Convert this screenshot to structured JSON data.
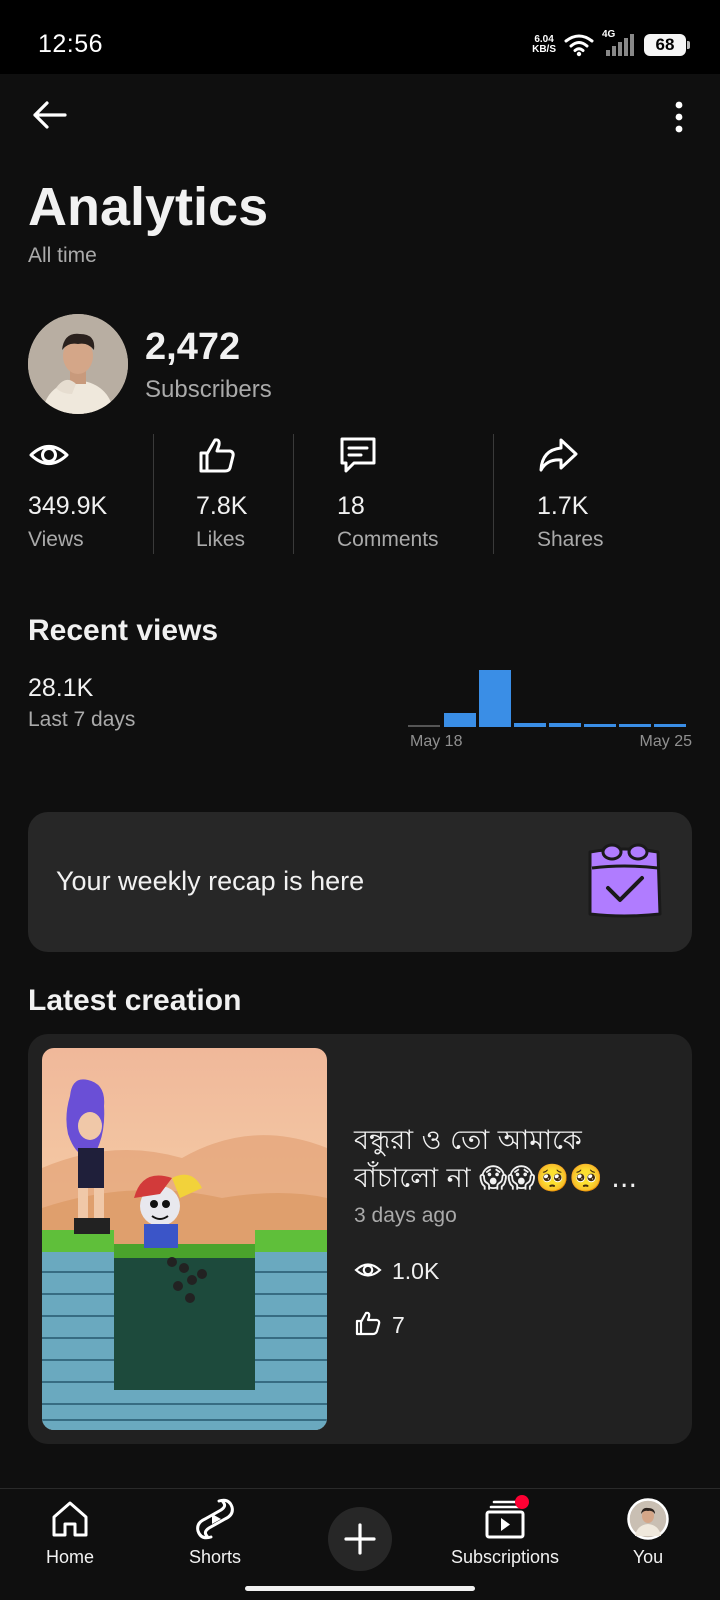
{
  "status_bar": {
    "time": "12:56",
    "net_speed_value": "6.04",
    "net_speed_unit": "KB/S",
    "network": "4G",
    "battery": "68"
  },
  "header": {
    "title": "Analytics",
    "subtitle": "All time"
  },
  "channel": {
    "subscribers_count": "2,472",
    "subscribers_label": "Subscribers"
  },
  "stats": [
    {
      "icon": "eye-icon",
      "value": "349.9K",
      "label": "Views"
    },
    {
      "icon": "thumbs-up-icon",
      "value": "7.8K",
      "label": "Likes"
    },
    {
      "icon": "comment-icon",
      "value": "18",
      "label": "Comments"
    },
    {
      "icon": "share-icon",
      "value": "1.7K",
      "label": "Shares"
    }
  ],
  "recent_views": {
    "title": "Recent views",
    "count": "28.1K",
    "period": "Last 7 days",
    "chart_start_label": "May 18",
    "chart_end_label": "May 25"
  },
  "recap": {
    "text": "Your weekly recap is here"
  },
  "latest_creation": {
    "section_title": "Latest creation",
    "video_title": "বন্ধুরা ও তো আমাকে বাঁচালো না 😱😱🥺🥺 ...",
    "age": "3 days ago",
    "views": "1.0K",
    "likes": "7"
  },
  "bottom_nav": {
    "home": "Home",
    "shorts": "Shorts",
    "subscriptions": "Subscriptions",
    "you": "You"
  },
  "colors": {
    "background": "#0f0f0f",
    "card": "#272727",
    "chart_bar": "#3a8ee6",
    "recap_icon": "#b07cff",
    "notification": "#ff0033"
  }
}
